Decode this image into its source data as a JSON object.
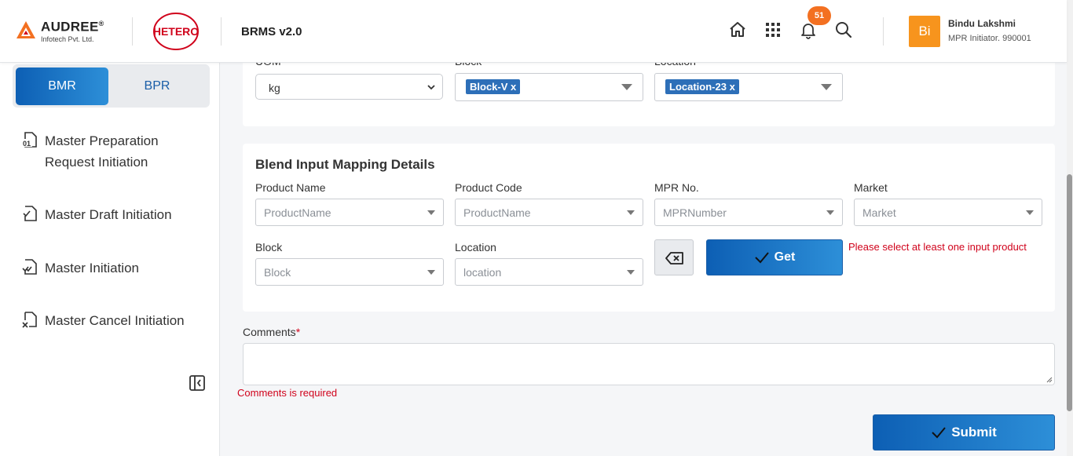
{
  "header": {
    "brand_name": "AUDREE",
    "brand_mark": "®",
    "brand_sub": "Infotech Pvt. Ltd.",
    "partner_logo": "HETERO",
    "app_title": "BRMS v2.0",
    "notification_count": "51",
    "icons": [
      "home-icon",
      "apps-grid-icon",
      "bell-icon",
      "search-icon"
    ],
    "user": {
      "initials": "Bi",
      "name": "Bindu Lakshmi",
      "role": "MPR Initiator. 990001"
    },
    "colors": {
      "accent_orange": "#f37021",
      "avatar": "#f7941d",
      "primary": "#0d5fb4"
    }
  },
  "sidebar": {
    "tabs": [
      {
        "label": "BMR",
        "active": true
      },
      {
        "label": "BPR",
        "active": false
      }
    ],
    "items": [
      {
        "label": "Master Preparation Request Initiation",
        "icon": "document-01-icon"
      },
      {
        "label": "Master Draft Initiation",
        "icon": "document-check-icon"
      },
      {
        "label": "Master Initiation",
        "icon": "document-double-check-icon"
      },
      {
        "label": "Master Cancel Initiation",
        "icon": "document-cancel-icon"
      }
    ],
    "collapse_icon": "collapse-sidebar-icon"
  },
  "top_card": {
    "uom": {
      "label": "UOM",
      "value": "kg"
    },
    "block": {
      "label": "Block",
      "tag": "Block-V x"
    },
    "location": {
      "label": "Location",
      "tag": "Location-23 x"
    }
  },
  "blend": {
    "title": "Blend Input Mapping Details",
    "product_name": {
      "label": "Product Name",
      "placeholder": "ProductName"
    },
    "product_code": {
      "label": "Product Code",
      "placeholder": "ProductName"
    },
    "mpr_no": {
      "label": "MPR No.",
      "placeholder": "MPRNumber"
    },
    "market": {
      "label": "Market",
      "placeholder": "Market"
    },
    "block": {
      "label": "Block",
      "placeholder": "Block"
    },
    "location": {
      "label": "Location",
      "placeholder": "location"
    },
    "get_button": "Get",
    "error": "Please select at least one input product"
  },
  "comments": {
    "label": "Comments",
    "required_mark": "*",
    "value": "",
    "error": "Comments is required"
  },
  "submit_button": "Submit"
}
